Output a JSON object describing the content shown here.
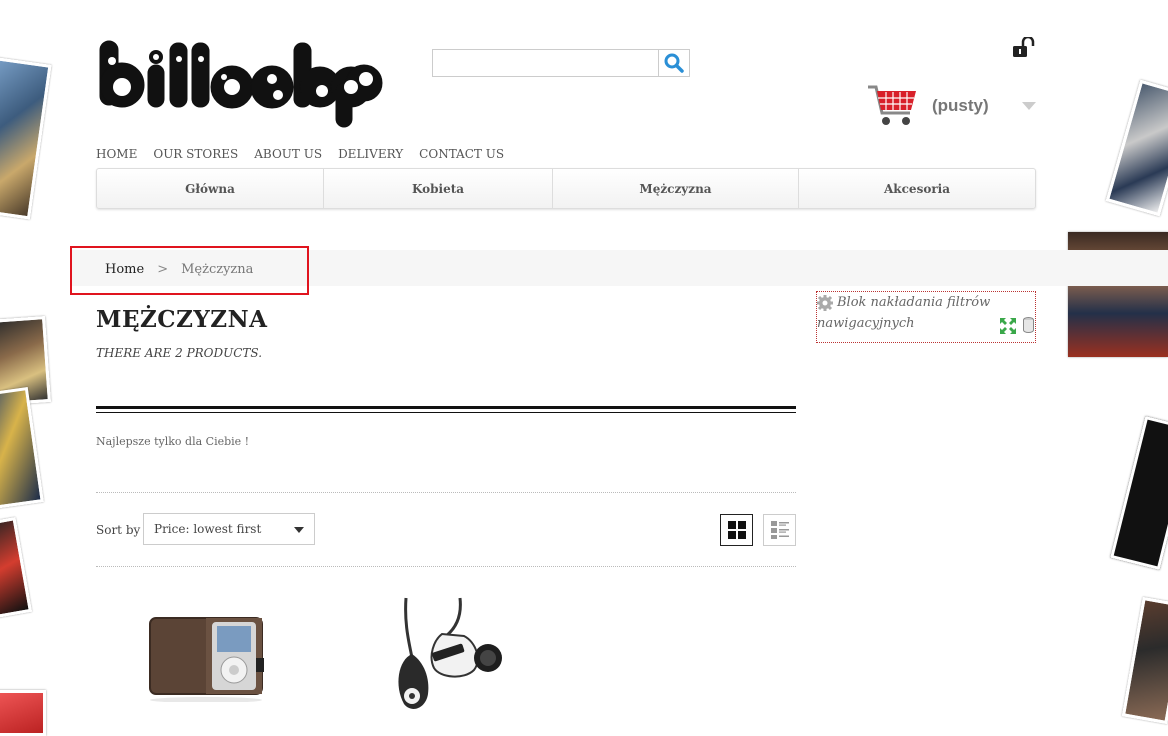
{
  "header": {
    "logo_text": "billoshop",
    "search": {
      "value": "",
      "placeholder": ""
    },
    "cart": {
      "status": "(pusty)"
    }
  },
  "top_nav": [
    "HOME",
    "OUR STORES",
    "ABOUT US",
    "DELIVERY",
    "CONTACT US"
  ],
  "menu": [
    "Główna",
    "Kobieta",
    "Mężczyzna",
    "Akcesoria"
  ],
  "breadcrumb": {
    "home": "Home",
    "separator": ">",
    "current": "Mężczyzna"
  },
  "category": {
    "title": "MĘŻCZYZNA",
    "count_text": "THERE ARE 2 PRODUCTS.",
    "description": "Najlepsze tylko dla Ciebie !"
  },
  "sort": {
    "label": "Sort by",
    "selected": "Price: lowest first"
  },
  "sidebar_widget": {
    "text": "Blok nakładania filtrów nawigacyjnych"
  },
  "colors": {
    "accent_red": "#e0141e",
    "search_icon": "#2a8fd6",
    "cart_red": "#d8202a"
  }
}
